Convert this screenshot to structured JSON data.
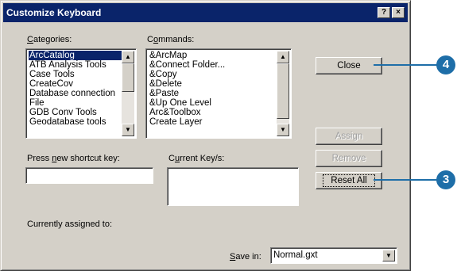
{
  "window": {
    "title": "Customize Keyboard",
    "help_button": "?",
    "close_button": "×"
  },
  "categories": {
    "label_underlined": "C",
    "label_rest": "ategories:",
    "items": [
      "ArcCatalog",
      "ATB Analysis Tools",
      "Case Tools",
      "CreateCov",
      "Database connection",
      "File",
      "GDB Conv Tools",
      "Geodatabase tools"
    ],
    "selected": "ArcCatalog"
  },
  "commands": {
    "label_pre": "C",
    "label_underlined": "o",
    "label_rest": "mmands:",
    "items": [
      "&ArcMap",
      "&Connect Folder...",
      "&Copy",
      "&Delete",
      "&Paste",
      "&Up One Level",
      "Arc&Toolbox",
      "Create Layer"
    ]
  },
  "buttons": {
    "close": "Close",
    "assign": "Assign",
    "remove": "Remove",
    "reset_all": "Reset All"
  },
  "shortcut": {
    "label_pre": "Press ",
    "label_underlined": "n",
    "label_rest": "ew shortcut key:",
    "value": ""
  },
  "current_keys": {
    "label_pre": "C",
    "label_underlined": "u",
    "label_rest": "rrent Key/s:"
  },
  "assigned": {
    "label": "Currently assigned to:"
  },
  "save_in": {
    "label_underlined": "S",
    "label_rest": "ave in:",
    "value": "Normal.gxt"
  },
  "callouts": {
    "close_step": "4",
    "reset_step": "3",
    "color": "#1e6ea8"
  },
  "colors": {
    "titlebar": "#0a246a",
    "dialog": "#d4d0c8"
  }
}
